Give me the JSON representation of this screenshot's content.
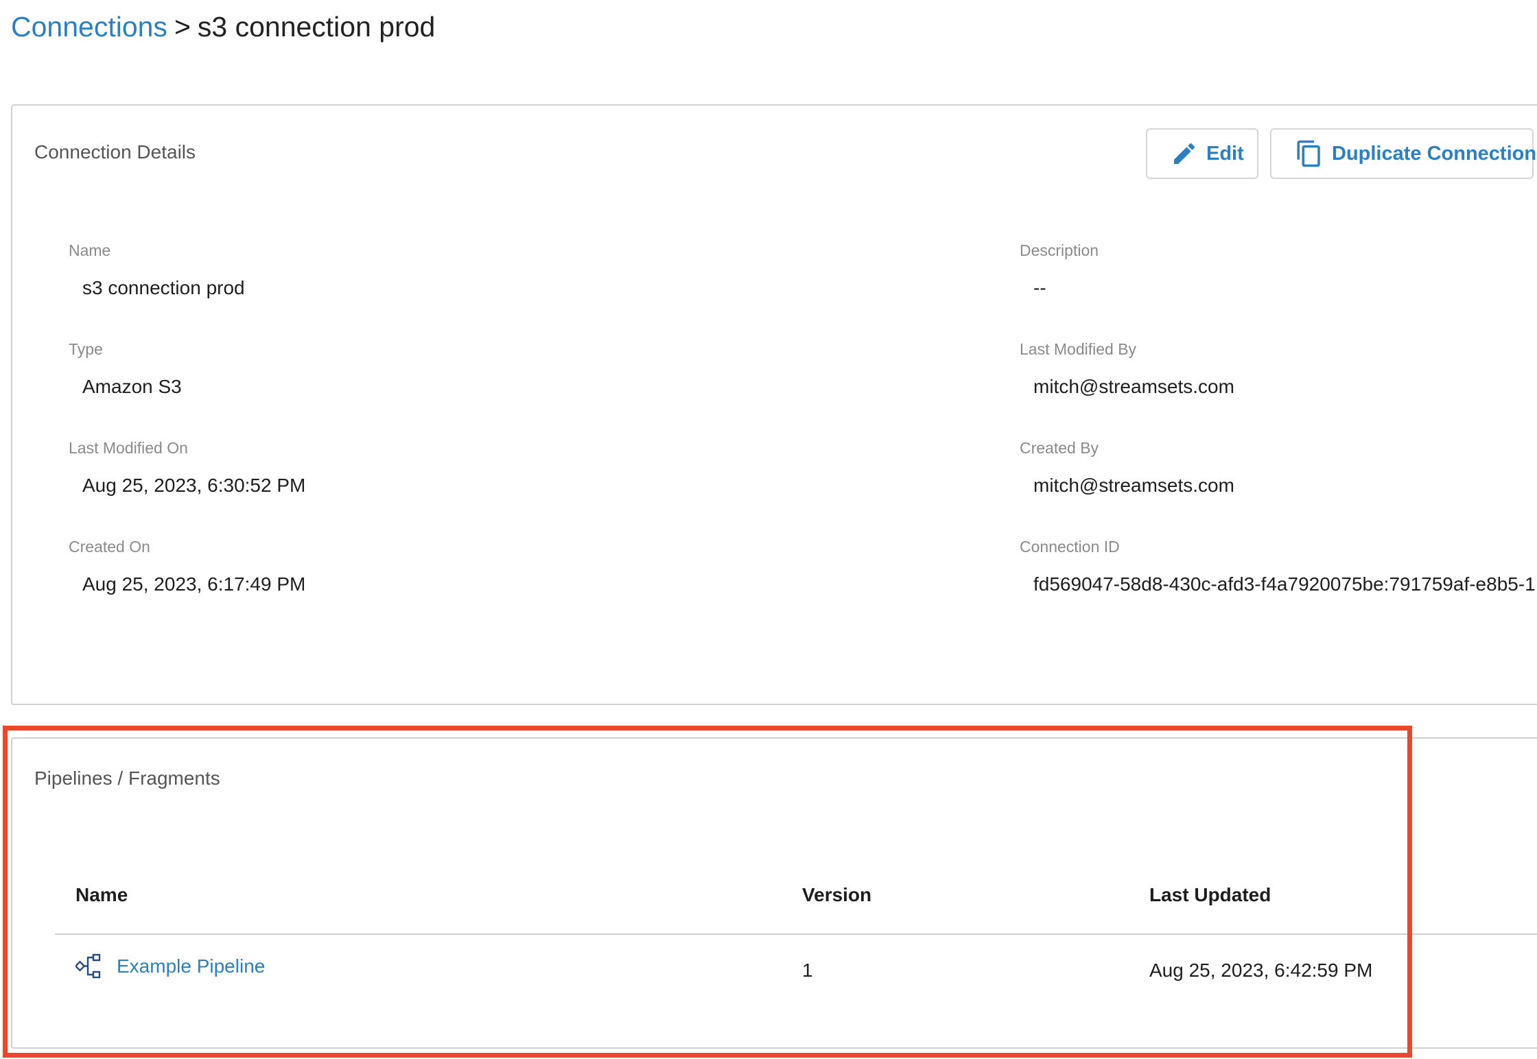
{
  "breadcrumb": {
    "root": "Connections",
    "separator": ">",
    "current": "s3 connection prod"
  },
  "details": {
    "title": "Connection Details",
    "edit_label": "Edit",
    "duplicate_label": "Duplicate Connection",
    "fields": {
      "name": {
        "label": "Name",
        "value": "s3 connection prod"
      },
      "description": {
        "label": "Description",
        "value": "--"
      },
      "type": {
        "label": "Type",
        "value": "Amazon S3"
      },
      "last_modified_by": {
        "label": "Last Modified By",
        "value": "mitch@streamsets.com"
      },
      "last_modified_on": {
        "label": "Last Modified On",
        "value": "Aug 25, 2023, 6:30:52 PM"
      },
      "created_by": {
        "label": "Created By",
        "value": "mitch@streamsets.com"
      },
      "created_on": {
        "label": "Created On",
        "value": "Aug 25, 2023, 6:17:49 PM"
      },
      "connection_id": {
        "label": "Connection ID",
        "value": "fd569047-58d8-430c-afd3-f4a7920075be:791759af-e8b5-1"
      }
    }
  },
  "pipelines": {
    "title": "Pipelines / Fragments",
    "columns": {
      "name": "Name",
      "version": "Version",
      "last_updated": "Last Updated"
    },
    "rows": [
      {
        "name": "Example Pipeline",
        "version": "1",
        "last_updated": "Aug 25, 2023, 6:42:59 PM"
      }
    ]
  },
  "icons": {
    "edit": "pencil-icon",
    "duplicate": "copy-icon",
    "pipeline": "pipeline-icon"
  },
  "colors": {
    "link": "#2c7fc0",
    "highlight": "#e9482f",
    "border": "#d0d0d0"
  }
}
